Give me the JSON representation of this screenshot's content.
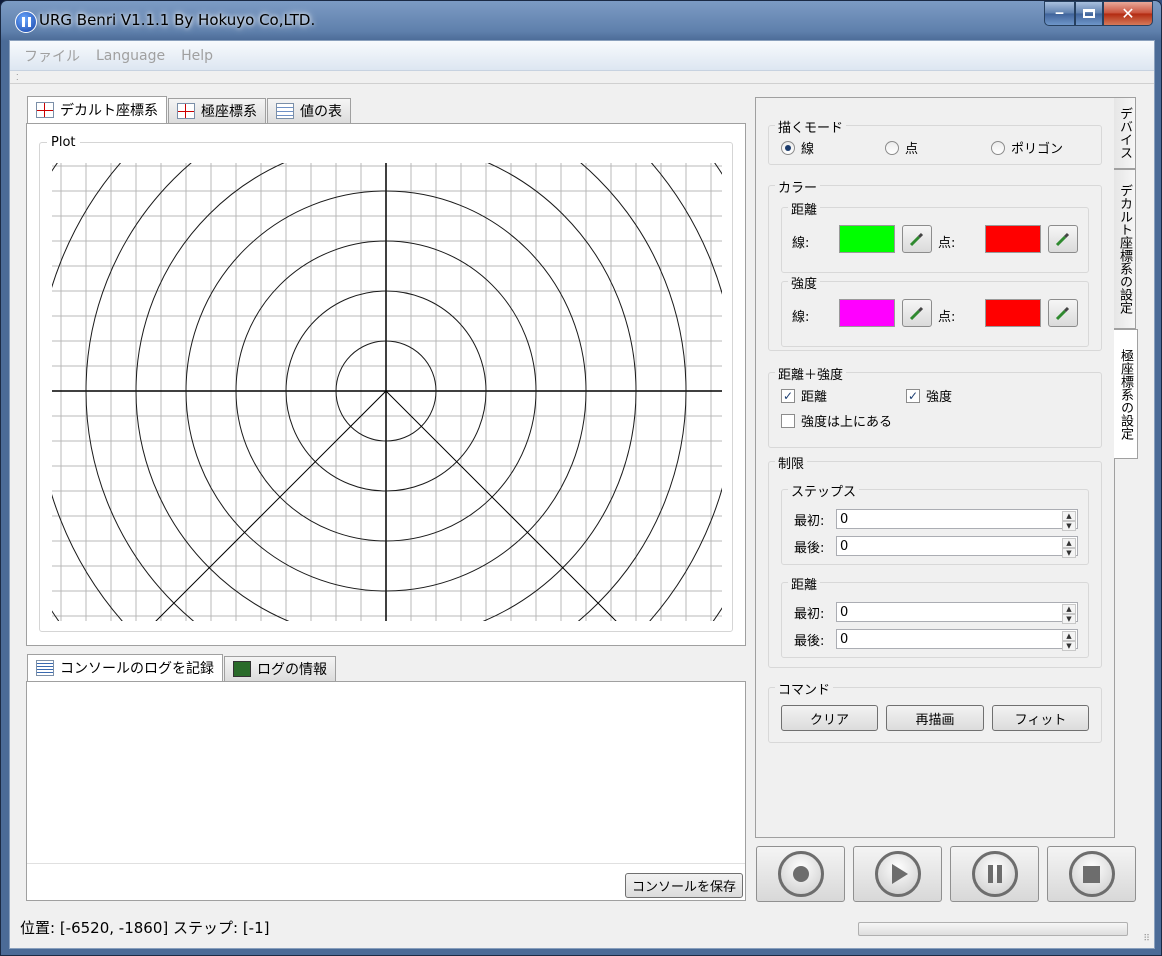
{
  "window": {
    "title": "URG Benri V1.1.1 By Hokuyo Co,LTD."
  },
  "menu": [
    "ファイル",
    "Language",
    "Help"
  ],
  "main_tabs": [
    {
      "label": "デカルト座標系",
      "icon": "graph-icon"
    },
    {
      "label": "極座標系",
      "icon": "graph-icon"
    },
    {
      "label": "値の表",
      "icon": "table-icon"
    }
  ],
  "plot": {
    "title": "Plot"
  },
  "log_tabs": [
    {
      "label": "コンソールのログを記録",
      "icon": "document-icon"
    },
    {
      "label": "ログの情報",
      "icon": "log-icon"
    }
  ],
  "console": {
    "save_label": "コンソールを保存"
  },
  "side_tabs": [
    "デバイス",
    "デカルト座標系の設定",
    "極座標系の設定"
  ],
  "draw_mode": {
    "title": "描くモード",
    "options": [
      "線",
      "点",
      "ポリゴン"
    ],
    "selected": "線"
  },
  "color": {
    "title": "カラー",
    "distance": {
      "title": "距離",
      "line_label": "線:",
      "point_label": "点:",
      "line_color": "#00ff00",
      "point_color": "#ff0000"
    },
    "intensity": {
      "title": "強度",
      "line_label": "線:",
      "point_label": "点:",
      "line_color": "#ff00ff",
      "point_color": "#ff0000"
    }
  },
  "dist_intensity": {
    "title": "距離＋強度",
    "distance_label": "距離",
    "distance_checked": true,
    "intensity_label": "強度",
    "intensity_checked": true,
    "intensity_top_label": "強度は上にある",
    "intensity_top_checked": false
  },
  "limits": {
    "title": "制限",
    "steps": {
      "title": "ステップス",
      "first_label": "最初:",
      "first_value": "0",
      "last_label": "最後:",
      "last_value": "0"
    },
    "distance": {
      "title": "距離",
      "first_label": "最初:",
      "first_value": "0",
      "last_label": "最後:",
      "last_value": "0"
    }
  },
  "commands": {
    "title": "コマンド",
    "clear": "クリア",
    "redraw": "再描画",
    "fit": "フィット"
  },
  "controls": [
    "record-icon",
    "play-icon",
    "pause-icon",
    "stop-icon"
  ],
  "status": {
    "text": "位置: [-6520, -1860] ステップ: [-1]"
  }
}
